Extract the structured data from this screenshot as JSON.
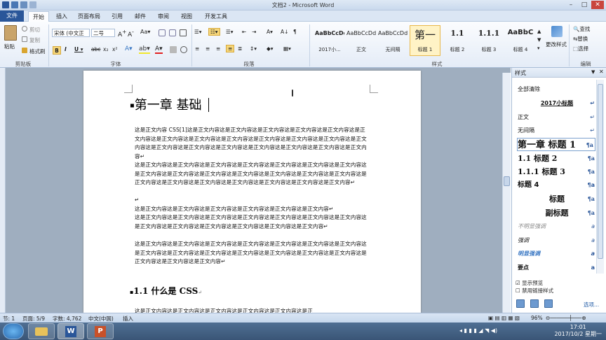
{
  "window": {
    "title": "文档2 - Microsoft Word"
  },
  "tabs": [
    "文件",
    "开始",
    "插入",
    "页面布局",
    "引用",
    "邮件",
    "审阅",
    "视图",
    "开发工具"
  ],
  "ribbon": {
    "clipboard": {
      "paste": "粘贴",
      "cut": "剪切",
      "copy": "复制",
      "format_painter": "格式刷",
      "label": "剪贴板"
    },
    "font": {
      "name": "宋体 (中文正",
      "size": "二号",
      "label": "字体"
    },
    "paragraph": {
      "label": "段落"
    },
    "styles": {
      "items": [
        {
          "preview": "AaBbCcDd",
          "name": "2017小..."
        },
        {
          "preview": "AaBbCcDd",
          "name": "正文"
        },
        {
          "preview": "AaBbCcDd",
          "name": "无间隔"
        },
        {
          "preview": "第一",
          "name": "标题 1"
        },
        {
          "preview": "1.1",
          "name": "标题 2"
        },
        {
          "preview": "1.1.1",
          "name": "标题 3"
        },
        {
          "preview": "AaBbC",
          "name": "标题 4"
        }
      ],
      "change": "更改样式",
      "label": "样式"
    },
    "editing": {
      "find": "查找",
      "replace": "替换",
      "select": "选择",
      "label": "编辑"
    }
  },
  "document": {
    "heading1": "第一章  基础",
    "para1": "这是正文内容 CSS[1]这是正文内容这是正文内容这是正文内容这是正文内容这是正文内容这是正文内容这是正文内容这是正文内容这是正文内容这是正文内容这是正文内容这是正文内容这是正文内容这是正文内容这是正文内容这是正文内容这是正文内容这是正文内容这是正文内容这是正文内容↵",
    "para2": "这是正文内容这是正文内容这是正文内容这是正文内容这是正文内容这是正文内容这是正文内容这是正文内容这是正文内容这是正文内容这是正文内容这是正文内容这是正文内容这是正文内容这是正文内容这是正文内容这是正文内容这是正文内容这是正文内容这是正文内容这是正文内容↵",
    "para3": "↵",
    "para4": "这是正文内容这是正文内容这是正文内容这是正文内容这是正文内容这是正文内容↵",
    "para5": "这是正文内容这是正文内容这是正文内容这是正文内容这是正文内容这是正文内容这是正文内容这是正文内容这是正文内容这是正文内容这是正文内容这是正文内容这是正文内容↵",
    "para6": "这是正文内容这是正文内容这是正文内容这是正文内容这是正文内容这是正文内容这是正文内容这是正文内容这是正文内容这是正文内容这是正文内容这是正文内容这是正文内容这是正文内容这是正文内容这是正文内容这是正文内容↵",
    "heading2": "1.1 什么是 CSS",
    "para7": "这是正文内容这是正文内容这是正文内容这是正文内容这是正文内容这是正"
  },
  "styles_pane": {
    "title": "样式",
    "items": [
      {
        "name": "全部清除",
        "mark": ""
      },
      {
        "name": "2017小标题",
        "mark": "↵"
      },
      {
        "name": "正文",
        "mark": "↵"
      },
      {
        "name": "无间隔",
        "mark": "↵"
      },
      {
        "name": "第一章 标题 1",
        "mark": "¶a"
      },
      {
        "name": "1.1 标题 2",
        "mark": "¶a"
      },
      {
        "name": "1.1.1 标题 3",
        "mark": "¶a"
      },
      {
        "name": "标题 4",
        "mark": "¶a"
      },
      {
        "name": "标题",
        "mark": "¶a"
      },
      {
        "name": "副标题",
        "mark": "¶a"
      },
      {
        "name": "不明显强调",
        "mark": "a"
      },
      {
        "name": "强调",
        "mark": "a"
      },
      {
        "name": "明显强调",
        "mark": "a"
      },
      {
        "name": "要点",
        "mark": "a"
      }
    ],
    "show_preview": "显示预览",
    "disable_linked": "禁用链接样式",
    "options": "选项..."
  },
  "statusbar": {
    "section": "节: 1",
    "page": "页面: 5/9",
    "words": "字数: 4,762",
    "language": "中文(中国)",
    "mode": "插入",
    "zoom": "96%"
  },
  "taskbar": {
    "time": "17:01",
    "date": "2017/10/2 星期一"
  }
}
